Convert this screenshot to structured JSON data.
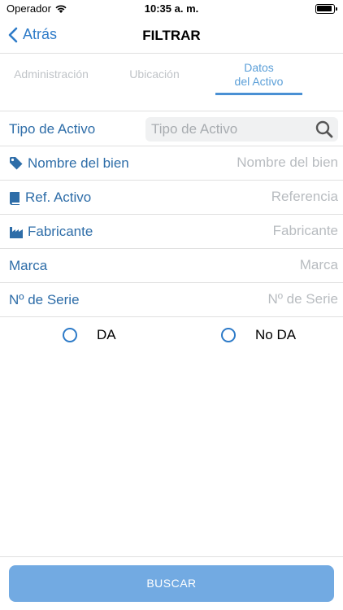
{
  "status_bar": {
    "carrier": "Operador",
    "time": "10:35 a. m."
  },
  "nav": {
    "back_label": "Atrás",
    "title": "FILTRAR"
  },
  "tabs": [
    {
      "label": "Administración",
      "active": false
    },
    {
      "label": "Ubicación",
      "active": false
    },
    {
      "label": "Datos\ndel Activo",
      "active": true
    }
  ],
  "form": {
    "tipo_activo": {
      "label": "Tipo de Activo",
      "placeholder": "Tipo de Activo",
      "icon": "search-icon"
    },
    "nombre_bien": {
      "label": "Nombre del bien",
      "placeholder": "Nombre del bien",
      "icon": "tag-icon"
    },
    "ref_activo": {
      "label": "Ref. Activo",
      "placeholder": "Referencia",
      "icon": "book-icon"
    },
    "fabricante": {
      "label": "Fabricante",
      "placeholder": "Fabricante",
      "icon": "factory-icon"
    },
    "marca": {
      "label": "Marca",
      "placeholder": "Marca"
    },
    "numero_serie": {
      "label": "Nº de Serie",
      "placeholder": "Nº de Serie"
    }
  },
  "radio": {
    "options": [
      {
        "label": "DA",
        "selected": false
      },
      {
        "label": "No DA",
        "selected": false
      }
    ]
  },
  "footer": {
    "buscar_label": "BUSCAR"
  },
  "colors": {
    "accent": "#2e7bc8",
    "label": "#2e6da8",
    "tab_inactive": "#c0c4c8",
    "button": "#72aae2"
  }
}
